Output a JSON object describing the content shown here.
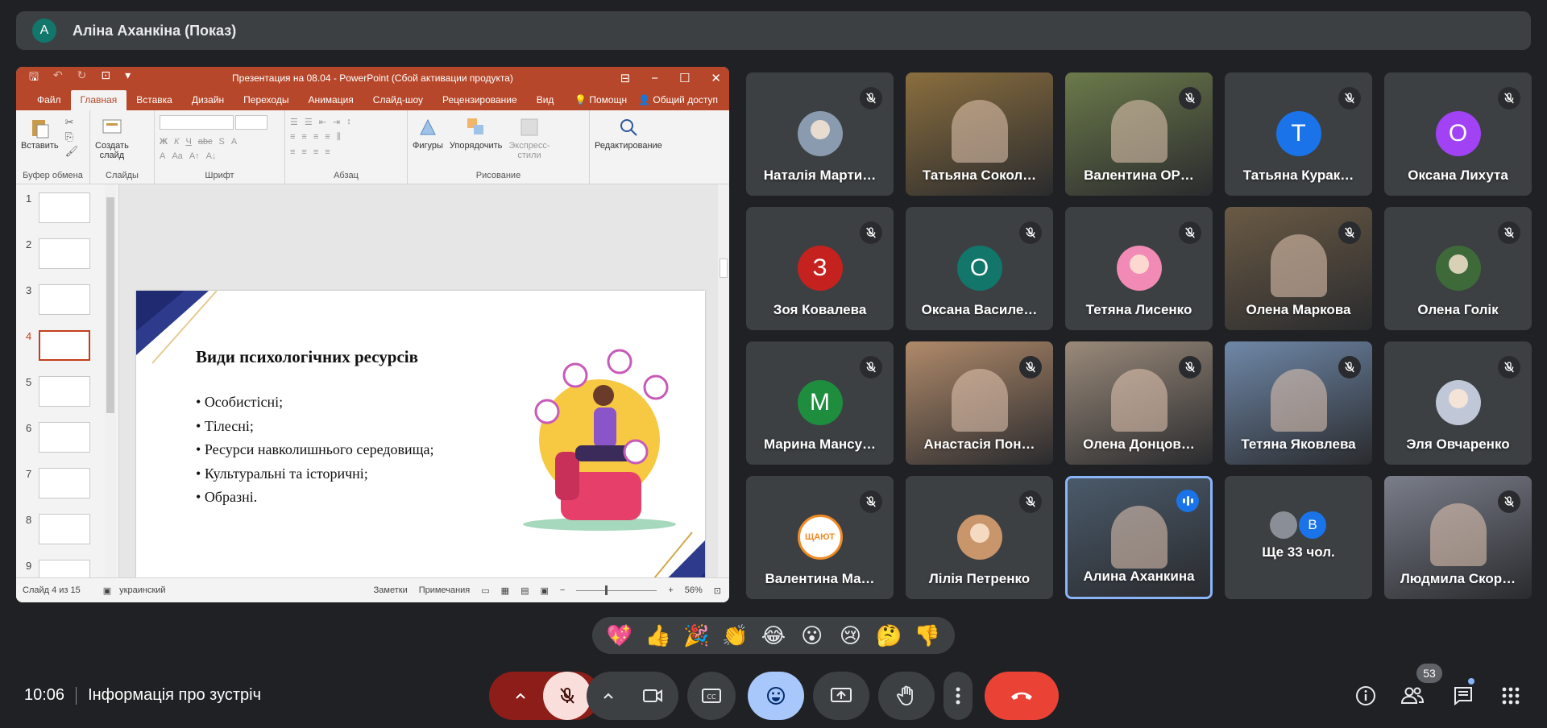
{
  "presenter": {
    "initial": "А",
    "name": "Аліна Аханкіна (Показ)"
  },
  "powerpoint": {
    "window_title": "Презентация на 08.04 - PowerPoint (Сбой активации продукта)",
    "tabs": [
      "Файл",
      "Главная",
      "Вставка",
      "Дизайн",
      "Переходы",
      "Анимация",
      "Слайд-шоу",
      "Рецензирование",
      "Вид"
    ],
    "active_tab": "Главная",
    "help": "Помощн",
    "share": "Общий доступ",
    "ribbon": {
      "paste": "Вставить",
      "create_slide_1": "Создать",
      "create_slide_2": "слайд",
      "shapes": "Фигуры",
      "arrange": "Упорядочить",
      "express_1": "Экспресс-",
      "express_2": "стили",
      "editing": "Редактирование",
      "groups": [
        "Буфер обмена",
        "Слайды",
        "Шрифт",
        "Абзац",
        "Рисование"
      ]
    },
    "thumbnails": [
      "1",
      "2",
      "3",
      "4",
      "5",
      "6",
      "7",
      "8",
      "9"
    ],
    "active_thumb": 3,
    "slide": {
      "title": "Види психологічних ресурсів",
      "bullets": [
        "Особистісні;",
        "Тілесні;",
        "Ресурси навколишнього середовища;",
        "Культуральні та історичні;",
        "Образні."
      ]
    },
    "status": {
      "slide_info": "Слайд 4 из 15",
      "language": "украинский",
      "notes": "Заметки",
      "comments": "Примечания",
      "zoom": "56%"
    }
  },
  "participants": [
    {
      "name": "Наталія Марти…",
      "kind": "photo",
      "color": "#8a9bb0",
      "muted": true
    },
    {
      "name": "Татьяна Сокол…",
      "kind": "video",
      "color": "#8a6e3e",
      "muted": false
    },
    {
      "name": "Валентина ОР…",
      "kind": "video",
      "color": "#6b7a4a",
      "muted": true
    },
    {
      "name": "Татьяна Курак…",
      "kind": "letter",
      "letter": "Т",
      "color": "#1a73e8",
      "muted": true
    },
    {
      "name": "Оксана Лихута",
      "kind": "letter",
      "letter": "О",
      "color": "#a142f4",
      "muted": true
    },
    {
      "name": "Зоя Ковалева",
      "kind": "letter",
      "letter": "З",
      "color": "#c5221f",
      "muted": true
    },
    {
      "name": "Оксана Василе…",
      "kind": "letter",
      "letter": "О",
      "color": "#12766a",
      "muted": true
    },
    {
      "name": "Тетяна Лисенко",
      "kind": "photo",
      "color": "#f28ab6",
      "muted": true
    },
    {
      "name": "Олена Маркова",
      "kind": "video",
      "color": "#6a5a44",
      "muted": true
    },
    {
      "name": "Олена Голік",
      "kind": "photo",
      "color": "#3e6a3a",
      "muted": true
    },
    {
      "name": "Марина Мансу…",
      "kind": "letter",
      "letter": "М",
      "color": "#1e8e3e",
      "muted": true
    },
    {
      "name": "Анастасія Пон…",
      "kind": "video",
      "color": "#b08a6a",
      "muted": true
    },
    {
      "name": "Олена Донцов…",
      "kind": "video",
      "color": "#9a8a7a",
      "muted": true
    },
    {
      "name": "Тетяна Яковлева",
      "kind": "video",
      "color": "#6f88a8",
      "muted": true
    },
    {
      "name": "Эля Овчаренко",
      "kind": "photo",
      "color": "#c0c8d8",
      "muted": true
    },
    {
      "name": "Валентина Ма…",
      "kind": "photo",
      "color": "#ffffff",
      "logo": "ЩАЮТ",
      "muted": true
    },
    {
      "name": "Лілія Петренко",
      "kind": "photo",
      "color": "#c9956a",
      "muted": true
    },
    {
      "name": "Алина Аханкина",
      "kind": "video",
      "color": "#4a5a6a",
      "muted": false,
      "speaking": true
    },
    {
      "name": "Ще 33 чол.",
      "kind": "more",
      "mini_letter": "В",
      "muted": false
    },
    {
      "name": "Людмила Скор…",
      "kind": "video",
      "color": "#7a7e8a",
      "muted": true
    }
  ],
  "reactions": [
    "💖",
    "👍",
    "🎉",
    "👏",
    "😂",
    "😮",
    "😢",
    "🤔",
    "👎"
  ],
  "bottom": {
    "time": "10:06",
    "meeting_info": "Інформація про зустріч",
    "participants_count": "53"
  },
  "colors": {
    "end_call": "#ea4335",
    "muted_mic": "#f9dedc",
    "active_emoji": "#a8c7fa",
    "accent": "#8ab4f8"
  }
}
